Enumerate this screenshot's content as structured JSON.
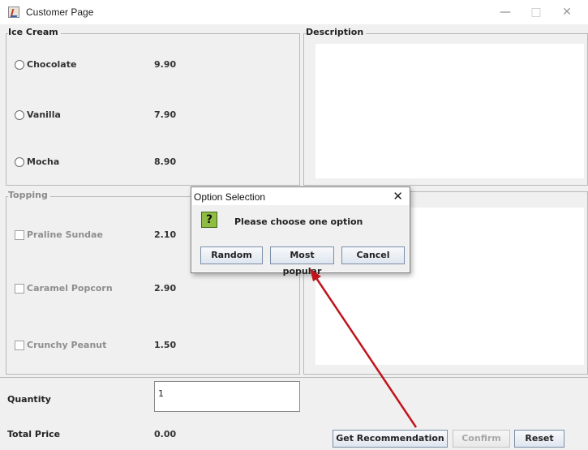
{
  "window": {
    "title": "Customer Page",
    "minimize": "—",
    "maximize": "□",
    "close": "✕"
  },
  "ice_cream": {
    "legend": "Ice Cream",
    "items": [
      {
        "label": "Chocolate",
        "price": "9.90"
      },
      {
        "label": "Vanilla",
        "price": "7.90"
      },
      {
        "label": "Mocha",
        "price": "8.90"
      }
    ]
  },
  "topping": {
    "legend": "Topping",
    "items": [
      {
        "label": "Praline Sundae",
        "price": "2.10"
      },
      {
        "label": "Caramel Popcorn",
        "price": "2.90"
      },
      {
        "label": "Crunchy Peanut",
        "price": "1.50"
      }
    ]
  },
  "description": {
    "legend": "Description"
  },
  "quantity": {
    "label": "Quantity",
    "value": "1"
  },
  "total": {
    "label": "Total Price",
    "value": "0.00"
  },
  "buttons": {
    "recommend": "Get Recommendation",
    "confirm": "Confirm",
    "reset": "Reset"
  },
  "dialog": {
    "title": "Option Selection",
    "close": "✕",
    "icon": "question-icon",
    "icon_glyph": "?",
    "message": "Please choose one option",
    "buttons": [
      "Random",
      "Most popular",
      "Cancel"
    ]
  },
  "annotation": {
    "arrow_color": "#c0141c"
  }
}
